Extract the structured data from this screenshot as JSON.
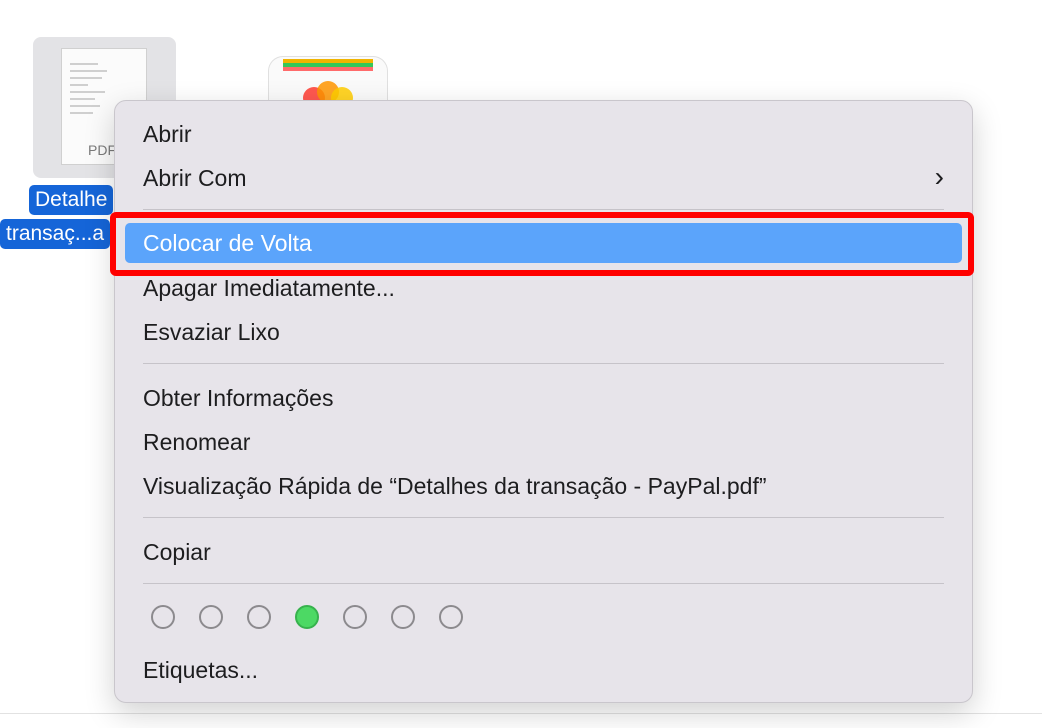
{
  "desktop": {
    "file": {
      "type_label": "PDF",
      "name_line1": "Detalhe",
      "name_line2": "transaç...a"
    }
  },
  "menu": {
    "items": [
      {
        "label": "Abrir"
      },
      {
        "label": "Abrir Com",
        "submenu_icon": "chevron-right-icon"
      },
      {
        "label": "Colocar de Volta",
        "highlighted": true
      },
      {
        "label": "Apagar Imediatamente..."
      },
      {
        "label": "Esvaziar Lixo"
      },
      {
        "label": "Obter Informações"
      },
      {
        "label": "Renomear"
      },
      {
        "label": "Visualização Rápida de “Detalhes da transação - PayPal.pdf”"
      },
      {
        "label": "Copiar"
      },
      {
        "label": "Etiquetas..."
      }
    ],
    "tag_colors": [
      {
        "name": "none",
        "color": null
      },
      {
        "name": "none",
        "color": null
      },
      {
        "name": "none",
        "color": null
      },
      {
        "name": "green",
        "color": "#4cd964"
      },
      {
        "name": "none",
        "color": null
      },
      {
        "name": "none",
        "color": null
      },
      {
        "name": "none",
        "color": null
      }
    ]
  },
  "colors": {
    "highlight": "#5ba4fb",
    "annotation": "#ff0000",
    "selection": "#1565d8"
  }
}
